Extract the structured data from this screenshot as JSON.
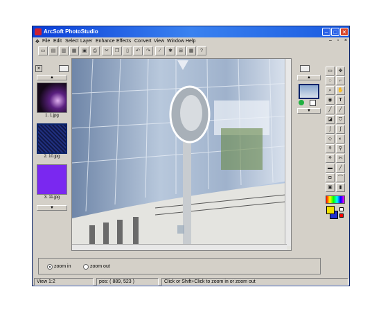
{
  "window": {
    "title": "ArcSoft PhotoStudio"
  },
  "menu": [
    "File",
    "Edit",
    "Select",
    "Layer",
    "Enhance",
    "Effects",
    "Convert",
    "View",
    "Window",
    "Help"
  ],
  "thumbnails": [
    {
      "label": "1. 1.jpg",
      "color": "#3a1a4a"
    },
    {
      "label": "2. 10.jpg",
      "color": "#1a2a66"
    },
    {
      "label": "3. 11.jpg",
      "color": "#7a28f0"
    }
  ],
  "options": {
    "zoom_in_label": "zoom in",
    "zoom_out_label": "zoom out",
    "selected": "zoom in"
  },
  "status": {
    "view": "View 1:2",
    "pos": "pos: ( 889, 523 )",
    "hint": "Click or Shift+Click to zoom in or zoom out"
  },
  "colors": {
    "title_bar": "#0a3ed8",
    "face": "#d4d0c8",
    "foreground": "#000000",
    "background": "#2030d0",
    "fg_swatch": "#f0e000"
  },
  "icons": {
    "toolbar": [
      "new-icon",
      "open-icon",
      "scan-icon",
      "print-icon",
      "save-icon",
      "print-preview-icon",
      "cut-icon",
      "copy-icon",
      "paste-icon",
      "undo-icon",
      "redo-icon",
      "magic-wand-icon",
      "settings-icon",
      "zoom-fit-icon",
      "calendar-icon",
      "help-icon"
    ],
    "tools": [
      "select-rect-icon",
      "move-icon",
      "lasso-icon",
      "crop-icon",
      "zoom-icon",
      "hand-icon",
      "eye-icon",
      "text-icon",
      "pen-icon",
      "brush-icon",
      "eraser-icon",
      "bucket-icon",
      "blur-icon",
      "smudge-icon",
      "sharpen-icon",
      "dodge-icon",
      "clone-icon",
      "stamp-icon",
      "line-icon",
      "shape-icon",
      "fill-icon",
      "gradient-icon",
      "picker-icon",
      "measure-icon"
    ]
  }
}
